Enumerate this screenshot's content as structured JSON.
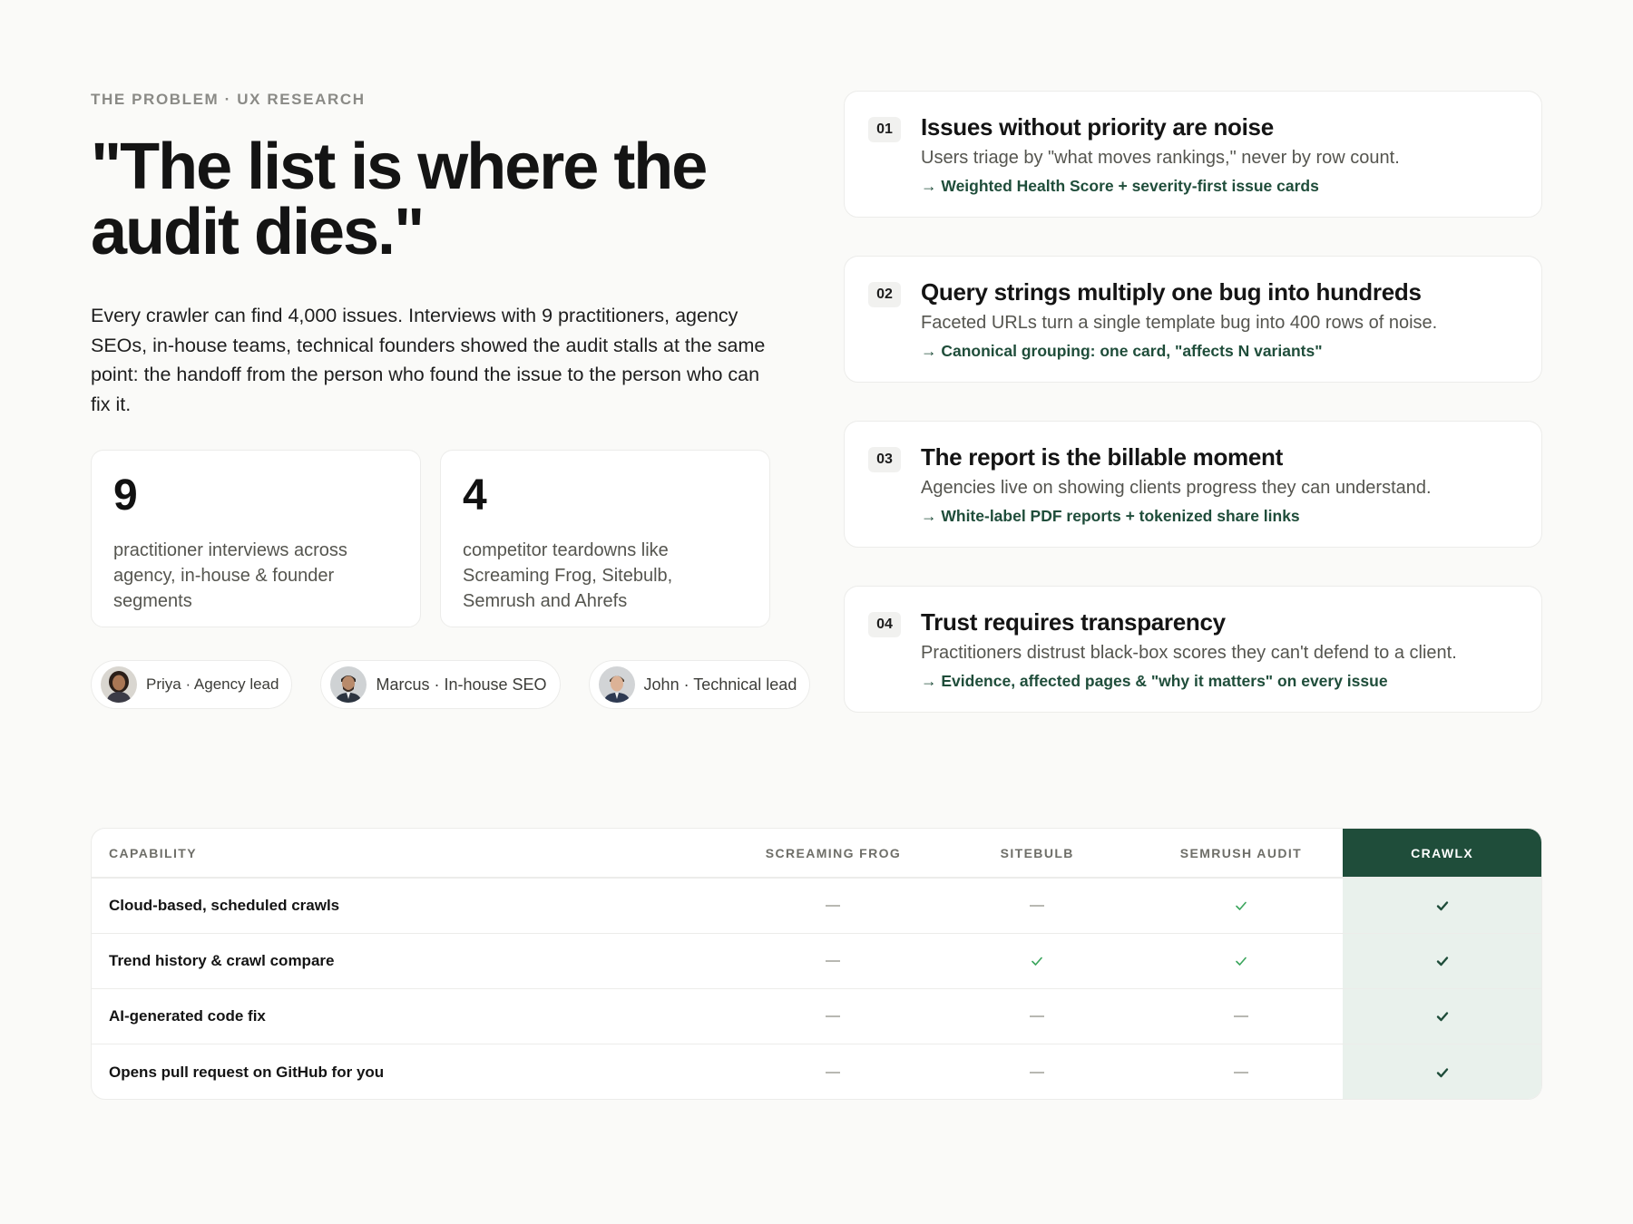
{
  "left": {
    "eyebrow": "THE PROBLEM · UX RESEARCH",
    "headline": "\"The list is where the audit dies.\"",
    "lede": "Every crawler can find 4,000 issues. Interviews with 9 practitioners, agency SEOs, in-house teams, technical founders showed the audit stalls at the same point: the handoff from the person who found the issue to the person who can fix it.",
    "stats": [
      {
        "number": "9",
        "text": "practitioner interviews across agency, in-house & founder segments"
      },
      {
        "number": "4",
        "text": "competitor teardowns like Screaming Frog, Sitebulb, Semrush and Ahrefs"
      }
    ],
    "personas": [
      {
        "label": "Priya · Agency lead",
        "avatar_icon": "avatar-woman-icon"
      },
      {
        "label": "Marcus · In-house SEO",
        "avatar_icon": "avatar-man-icon"
      },
      {
        "label": "John · Technical lead",
        "avatar_icon": "avatar-man-icon"
      }
    ]
  },
  "findings": [
    {
      "number": "01",
      "title": "Issues without priority are noise",
      "description": "Users triage by \"what moves rankings,\" never by row count.",
      "outcome": "→ Weighted Health Score + severity-first issue cards"
    },
    {
      "number": "02",
      "title": "Query strings multiply one bug into hundreds",
      "description": "Faceted URLs turn a single template bug into 400 rows of noise.",
      "outcome": "→ Canonical grouping: one card, \"affects N variants\""
    },
    {
      "number": "03",
      "title": "The report is the billable moment",
      "description": "Agencies live on showing clients progress they can understand.",
      "outcome": "→ White-label PDF reports + tokenized share links"
    },
    {
      "number": "04",
      "title": "Trust requires transparency",
      "description": "Practitioners distrust black-box scores they can't defend to a client.",
      "outcome": "→ Evidence, affected pages & \"why it matters\" on every issue"
    }
  ],
  "table": {
    "headers": [
      "CAPABILITY",
      "SCREAMING FROG",
      "SITEBULB",
      "SEMRUSH AUDIT",
      "CRAWLX"
    ],
    "rows": [
      {
        "capability": "Cloud-based, scheduled crawls",
        "values": [
          false,
          false,
          true,
          true
        ]
      },
      {
        "capability": "Trend history & crawl compare",
        "values": [
          false,
          true,
          true,
          true
        ]
      },
      {
        "capability": "AI-generated code fix",
        "values": [
          false,
          false,
          false,
          true
        ]
      },
      {
        "capability": "Opens pull request on GitHub for you",
        "values": [
          false,
          false,
          false,
          true
        ]
      }
    ]
  },
  "colors": {
    "accent_dark_green": "#1f4d3a",
    "highlight_bg": "#e9f1ec",
    "check_green": "#3aa55c",
    "background": "#fafaf8"
  }
}
